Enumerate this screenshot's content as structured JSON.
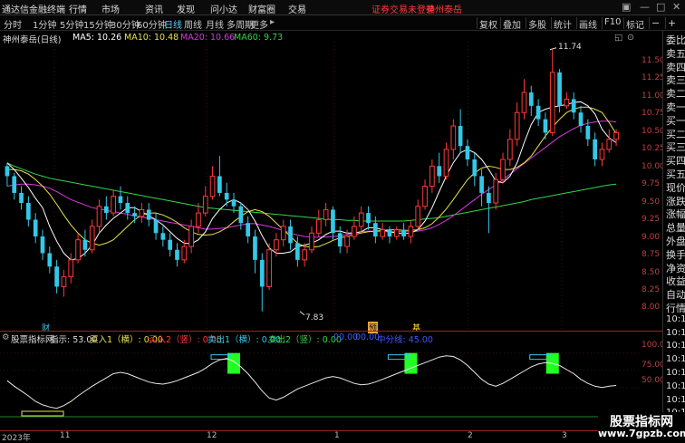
{
  "menu": {
    "app_title": "通达信金融终端",
    "items": [
      "行情",
      "市场",
      "资讯",
      "发现",
      "问小达",
      "财富圈",
      "交易"
    ],
    "status_text": "证券交易未登录",
    "stock_name": "神州泰岳"
  },
  "toolbar": {
    "periods": [
      "分时",
      "1分钟",
      "5分钟",
      "15分钟",
      "30分钟",
      "60分钟",
      "日线",
      "周线",
      "月线",
      "多周期",
      "更多"
    ],
    "active_period": "日线",
    "actions": [
      "复权",
      "叠加",
      "多股",
      "统计",
      "画线",
      "F10",
      "标记"
    ],
    "minus_icon": "−",
    "plus_icon": "+"
  },
  "main_info": {
    "title": "神州泰岳(日线)",
    "ma5": "MA5: 10.26",
    "ma10": "MA10: 10.48",
    "ma20": "MA20: 10.66",
    "ma60": "MA60: 9.73",
    "ma5_color": "#ffffff",
    "ma10_color": "#e8e24a",
    "ma20_color": "#d838e0",
    "ma60_color": "#33d64a"
  },
  "y_axis": [
    "11.50",
    "11.25",
    "11.00",
    "10.75",
    "10.50",
    "10.25",
    "10.00",
    "9.75",
    "9.50",
    "9.25",
    "9.00",
    "8.75",
    "8.50",
    "8.25",
    "8.00"
  ],
  "high_label": "11.74",
  "low_label": "7.83",
  "event_markers": [
    "财",
    "预",
    "基"
  ],
  "indicator": {
    "name": "股票指标网",
    "zhishi": "指示: 53.00",
    "buy1": "买入1（横）: 0.00",
    "buy2": "买入2（竖）: 0.00",
    "sell1": "卖出1（横）: 0.00",
    "sell2": "卖出2（竖）: 0.00",
    "v1": "00.00",
    "v2": "00.00",
    "center": "中分线: 45.00",
    "y_axis": [
      "100.00",
      "75.00",
      "50.00"
    ]
  },
  "x_axis": [
    "2023年",
    "11",
    "12",
    "1",
    "2",
    "3"
  ],
  "side_panel": [
    "委比",
    "卖五",
    "卖四",
    "卖三",
    "卖二",
    "卖一",
    "买一",
    "买二",
    "买三",
    "买四",
    "买五",
    "现价",
    "涨跌",
    "涨幅",
    "总量",
    "外盘",
    "换手",
    "净资",
    "收益",
    "自动",
    "行情",
    "10:1",
    "10:1",
    "10:1",
    "10:1",
    "10:1",
    "10:1",
    "10:1",
    "10:1",
    "10:1"
  ],
  "watermark": {
    "line1": "股票指标网",
    "line2": "www.7gpzb.com"
  },
  "chart_data": {
    "type": "candlestick",
    "price_range": [
      7.8,
      11.75
    ],
    "up_color": "#ff3a3a",
    "down_color": "#33c8e8",
    "candles": [
      [
        10.0,
        9.85,
        10.05,
        9.7
      ],
      [
        9.85,
        9.6,
        9.9,
        9.5
      ],
      [
        9.6,
        9.45,
        9.7,
        9.35
      ],
      [
        9.45,
        9.2,
        9.55,
        9.1
      ],
      [
        9.2,
        8.95,
        9.3,
        8.85
      ],
      [
        8.95,
        8.7,
        9.05,
        8.6
      ],
      [
        8.7,
        8.5,
        8.8,
        8.4
      ],
      [
        8.5,
        8.2,
        8.6,
        8.1
      ],
      [
        8.2,
        8.35,
        8.45,
        8.05
      ],
      [
        8.35,
        8.6,
        8.7,
        8.25
      ],
      [
        8.6,
        8.9,
        9.0,
        8.55
      ],
      [
        8.9,
        8.75,
        9.05,
        8.65
      ],
      [
        8.75,
        9.1,
        9.2,
        8.7
      ],
      [
        9.1,
        9.4,
        9.5,
        9.0
      ],
      [
        9.4,
        9.3,
        9.55,
        9.2
      ],
      [
        9.3,
        9.55,
        9.65,
        9.25
      ],
      [
        9.55,
        9.45,
        9.7,
        9.35
      ],
      [
        9.45,
        9.3,
        9.55,
        9.2
      ],
      [
        9.3,
        9.25,
        9.4,
        9.15
      ],
      [
        9.25,
        9.35,
        9.45,
        9.15
      ],
      [
        9.35,
        9.2,
        9.45,
        9.1
      ],
      [
        9.2,
        9.0,
        9.3,
        8.9
      ],
      [
        9.0,
        8.9,
        9.1,
        8.8
      ],
      [
        8.9,
        8.75,
        9.0,
        8.65
      ],
      [
        8.75,
        8.6,
        8.85,
        8.5
      ],
      [
        8.6,
        8.8,
        8.9,
        8.55
      ],
      [
        8.8,
        9.1,
        9.2,
        8.7
      ],
      [
        9.1,
        9.3,
        9.45,
        9.0
      ],
      [
        9.3,
        9.55,
        9.7,
        9.25
      ],
      [
        9.55,
        9.85,
        10.0,
        9.5
      ],
      [
        9.85,
        9.6,
        10.15,
        9.55
      ],
      [
        9.6,
        9.5,
        9.75,
        9.4
      ],
      [
        9.5,
        9.4,
        9.6,
        9.3
      ],
      [
        9.4,
        9.15,
        9.45,
        9.05
      ],
      [
        9.15,
        8.95,
        9.25,
        8.85
      ],
      [
        8.95,
        8.6,
        9.05,
        8.4
      ],
      [
        8.6,
        8.2,
        8.7,
        7.83
      ],
      [
        8.2,
        8.75,
        8.85,
        8.15
      ],
      [
        8.75,
        8.9,
        9.0,
        8.65
      ],
      [
        8.9,
        9.1,
        9.2,
        8.8
      ],
      [
        9.1,
        8.85,
        9.2,
        8.75
      ],
      [
        8.85,
        8.6,
        8.95,
        8.5
      ],
      [
        8.6,
        8.75,
        8.85,
        8.5
      ],
      [
        8.75,
        9.0,
        9.1,
        8.7
      ],
      [
        9.0,
        9.2,
        9.35,
        8.95
      ],
      [
        9.2,
        9.35,
        9.45,
        9.1
      ],
      [
        9.35,
        9.0,
        9.4,
        8.9
      ],
      [
        9.0,
        8.8,
        9.1,
        8.7
      ],
      [
        8.8,
        8.95,
        9.05,
        8.7
      ],
      [
        8.95,
        9.1,
        9.25,
        8.9
      ],
      [
        9.1,
        9.3,
        9.4,
        9.0
      ],
      [
        9.3,
        9.15,
        9.4,
        9.05
      ],
      [
        9.15,
        8.95,
        9.25,
        8.85
      ],
      [
        8.95,
        9.05,
        9.15,
        8.9
      ],
      [
        9.05,
        8.95,
        9.1,
        8.85
      ],
      [
        8.95,
        9.05,
        9.1,
        8.9
      ],
      [
        9.05,
        8.95,
        9.15,
        8.9
      ],
      [
        8.95,
        9.1,
        9.2,
        8.85
      ],
      [
        9.1,
        9.4,
        9.5,
        9.05
      ],
      [
        9.4,
        9.7,
        9.8,
        9.35
      ],
      [
        9.7,
        10.0,
        10.1,
        9.6
      ],
      [
        10.0,
        9.85,
        10.2,
        9.75
      ],
      [
        9.85,
        10.25,
        10.35,
        9.8
      ],
      [
        10.25,
        10.6,
        10.7,
        10.1
      ],
      [
        10.6,
        10.3,
        10.85,
        10.2
      ],
      [
        10.3,
        10.1,
        10.4,
        10.0
      ],
      [
        10.1,
        9.85,
        10.2,
        9.7
      ],
      [
        9.85,
        9.6,
        9.95,
        9.4
      ],
      [
        9.6,
        9.45,
        9.7,
        9.0
      ],
      [
        9.45,
        9.8,
        9.9,
        9.35
      ],
      [
        9.8,
        10.1,
        10.2,
        9.75
      ],
      [
        10.1,
        10.4,
        10.55,
        10.0
      ],
      [
        10.4,
        10.8,
        10.95,
        10.3
      ],
      [
        10.8,
        11.1,
        11.3,
        10.7
      ],
      [
        11.1,
        10.9,
        11.2,
        10.75
      ],
      [
        10.9,
        10.7,
        11.0,
        10.6
      ],
      [
        10.7,
        10.5,
        10.8,
        10.4
      ],
      [
        10.5,
        11.4,
        11.74,
        10.45
      ],
      [
        11.4,
        10.9,
        11.45,
        10.8
      ],
      [
        10.9,
        11.0,
        11.1,
        10.85
      ],
      [
        11.0,
        10.8,
        11.1,
        10.7
      ],
      [
        10.8,
        10.6,
        10.9,
        10.5
      ],
      [
        10.6,
        10.4,
        10.7,
        10.3
      ],
      [
        10.4,
        10.1,
        10.5,
        10.0
      ],
      [
        10.1,
        10.25,
        10.35,
        10.0
      ],
      [
        10.25,
        10.4,
        10.55,
        10.2
      ],
      [
        10.4,
        10.5,
        10.55,
        10.3
      ]
    ],
    "ma5": [
      10.05,
      9.95,
      9.82,
      9.68,
      9.52,
      9.38,
      9.1,
      8.88,
      8.7,
      8.6,
      8.62,
      8.7,
      8.82,
      9.0,
      9.12,
      9.22,
      9.3,
      9.38,
      9.38,
      9.32,
      9.26,
      9.2,
      9.12,
      9.02,
      8.92,
      8.85,
      8.84,
      8.9,
      9.02,
      9.22,
      9.35,
      9.45,
      9.5,
      9.45,
      9.35,
      9.18,
      8.96,
      8.78,
      8.7,
      8.7,
      8.72,
      8.8,
      8.82,
      8.85,
      8.9,
      8.98,
      9.03,
      9.03,
      9.0,
      9.0,
      9.02,
      9.08,
      9.08,
      9.05,
      9.02,
      9.0,
      8.99,
      9.0,
      9.05,
      9.18,
      9.38,
      9.62,
      9.85,
      10.05,
      10.2,
      10.25,
      10.2,
      10.1,
      9.95,
      9.78,
      9.75,
      9.85,
      10.05,
      10.35,
      10.62,
      10.8,
      10.85,
      10.88,
      10.9,
      10.92,
      10.95,
      10.96,
      10.9,
      10.78,
      10.55,
      10.42,
      10.35
    ],
    "ma10": [
      9.95,
      9.95,
      9.93,
      9.88,
      9.8,
      9.7,
      9.58,
      9.43,
      9.27,
      9.12,
      9.0,
      8.9,
      8.85,
      8.82,
      8.85,
      8.9,
      9.0,
      9.1,
      9.2,
      9.27,
      9.3,
      9.3,
      9.27,
      9.22,
      9.16,
      9.08,
      9.02,
      8.98,
      8.97,
      8.98,
      9.02,
      9.08,
      9.17,
      9.25,
      9.32,
      9.35,
      9.32,
      9.25,
      9.15,
      9.05,
      8.95,
      8.85,
      8.8,
      8.79,
      8.8,
      8.84,
      8.89,
      8.93,
      8.95,
      8.98,
      9.0,
      9.02,
      9.03,
      9.04,
      9.05,
      9.05,
      9.04,
      9.04,
      9.05,
      9.08,
      9.14,
      9.24,
      9.36,
      9.5,
      9.65,
      9.8,
      9.9,
      9.97,
      10.0,
      9.98,
      9.95,
      9.95,
      9.98,
      10.05,
      10.15,
      10.3,
      10.45,
      10.58,
      10.7,
      10.8,
      10.85,
      10.88,
      10.88,
      10.85,
      10.8,
      10.65,
      10.48
    ],
    "ma20": [
      9.7,
      9.72,
      9.73,
      9.73,
      9.72,
      9.7,
      9.67,
      9.62,
      9.56,
      9.5,
      9.46,
      9.42,
      9.38,
      9.36,
      9.34,
      9.32,
      9.3,
      9.28,
      9.26,
      9.24,
      9.22,
      9.2,
      9.18,
      9.16,
      9.14,
      9.12,
      9.1,
      9.08,
      9.06,
      9.06,
      9.07,
      9.08,
      9.1,
      9.12,
      9.14,
      9.14,
      9.12,
      9.1,
      9.07,
      9.04,
      9.0,
      8.97,
      8.95,
      8.94,
      8.94,
      8.94,
      8.95,
      8.96,
      8.98,
      9.0,
      9.02,
      9.03,
      9.03,
      9.02,
      9.02,
      9.02,
      9.02,
      9.02,
      9.03,
      9.05,
      9.08,
      9.13,
      9.19,
      9.26,
      9.34,
      9.42,
      9.5,
      9.58,
      9.65,
      9.72,
      9.8,
      9.88,
      9.96,
      10.04,
      10.12,
      10.2,
      10.28,
      10.36,
      10.44,
      10.5,
      10.56,
      10.61,
      10.64,
      10.66,
      10.67,
      10.67,
      10.66
    ],
    "ma60": [
      10.05,
      10.0,
      9.96,
      9.92,
      9.88,
      9.85,
      9.82,
      9.8,
      9.78,
      9.76,
      9.74,
      9.72,
      9.7,
      9.68,
      9.66,
      9.64,
      9.62,
      9.6,
      9.58,
      9.56,
      9.54,
      9.52,
      9.5,
      9.48,
      9.46,
      9.44,
      9.42,
      9.4,
      9.38,
      9.37,
      9.36,
      9.35,
      9.34,
      9.33,
      9.32,
      9.31,
      9.3,
      9.29,
      9.28,
      9.27,
      9.26,
      9.25,
      9.24,
      9.23,
      9.22,
      9.21,
      9.2,
      9.2,
      9.19,
      9.19,
      9.18,
      9.18,
      9.18,
      9.18,
      9.18,
      9.18,
      9.18,
      9.19,
      9.2,
      9.21,
      9.22,
      9.23,
      9.25,
      9.27,
      9.29,
      9.31,
      9.33,
      9.35,
      9.37,
      9.39,
      9.41,
      9.43,
      9.45,
      9.47,
      9.5,
      9.52,
      9.54,
      9.56,
      9.58,
      9.6,
      9.62,
      9.64,
      9.66,
      9.68,
      9.7,
      9.72,
      9.73
    ],
    "indicator_range": [
      0,
      110
    ],
    "indicator_line": [
      60,
      52,
      45,
      38,
      30,
      25,
      22,
      20,
      24,
      30,
      38,
      45,
      52,
      58,
      64,
      70,
      72,
      70,
      66,
      62,
      58,
      56,
      55,
      57,
      60,
      64,
      68,
      72,
      78,
      85,
      90,
      92,
      88,
      80,
      70,
      58,
      45,
      35,
      32,
      36,
      42,
      48,
      52,
      56,
      60,
      64,
      66,
      64,
      60,
      56,
      54,
      55,
      58,
      62,
      66,
      70,
      74,
      78,
      82,
      86,
      90,
      94,
      96,
      95,
      90,
      82,
      72,
      62,
      55,
      52,
      56,
      62,
      68,
      74,
      80,
      84,
      86,
      85,
      82,
      76,
      70,
      62,
      56,
      52,
      50,
      52,
      53
    ],
    "indicator_bars": [
      [
        32,
        70,
        100
      ],
      [
        57,
        70,
        100
      ],
      [
        77,
        70,
        100
      ]
    ]
  }
}
